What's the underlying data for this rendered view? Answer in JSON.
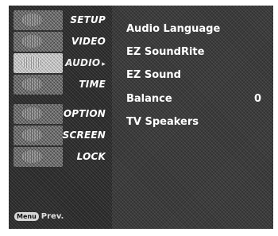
{
  "sidebar": {
    "items": [
      {
        "label": "SETUP",
        "icon": "setup-thumbnail-icon",
        "active": false
      },
      {
        "label": "VIDEO",
        "icon": "video-thumbnail-icon",
        "active": false
      },
      {
        "label": "AUDIO",
        "icon": "audio-thumbnail-icon",
        "active": true,
        "arrow": "▸"
      },
      {
        "label": "TIME",
        "icon": "time-thumbnail-icon",
        "active": false
      },
      {
        "label": "OPTION",
        "icon": "option-thumbnail-icon",
        "active": false
      },
      {
        "label": "SCREEN",
        "icon": "screen-thumbnail-icon",
        "active": false
      },
      {
        "label": "LOCK",
        "icon": "lock-thumbnail-icon",
        "active": false
      }
    ],
    "footer": {
      "key_label": "Menu",
      "action_label": "Prev."
    }
  },
  "audio_menu": {
    "options": [
      {
        "label": "Audio Language"
      },
      {
        "label": "EZ SoundRite"
      },
      {
        "label": "EZ Sound"
      },
      {
        "label": "Balance",
        "value": "0"
      },
      {
        "label": "TV Speakers"
      }
    ]
  },
  "colors": {
    "osd_background": "#101010",
    "text": "#ffffff"
  }
}
